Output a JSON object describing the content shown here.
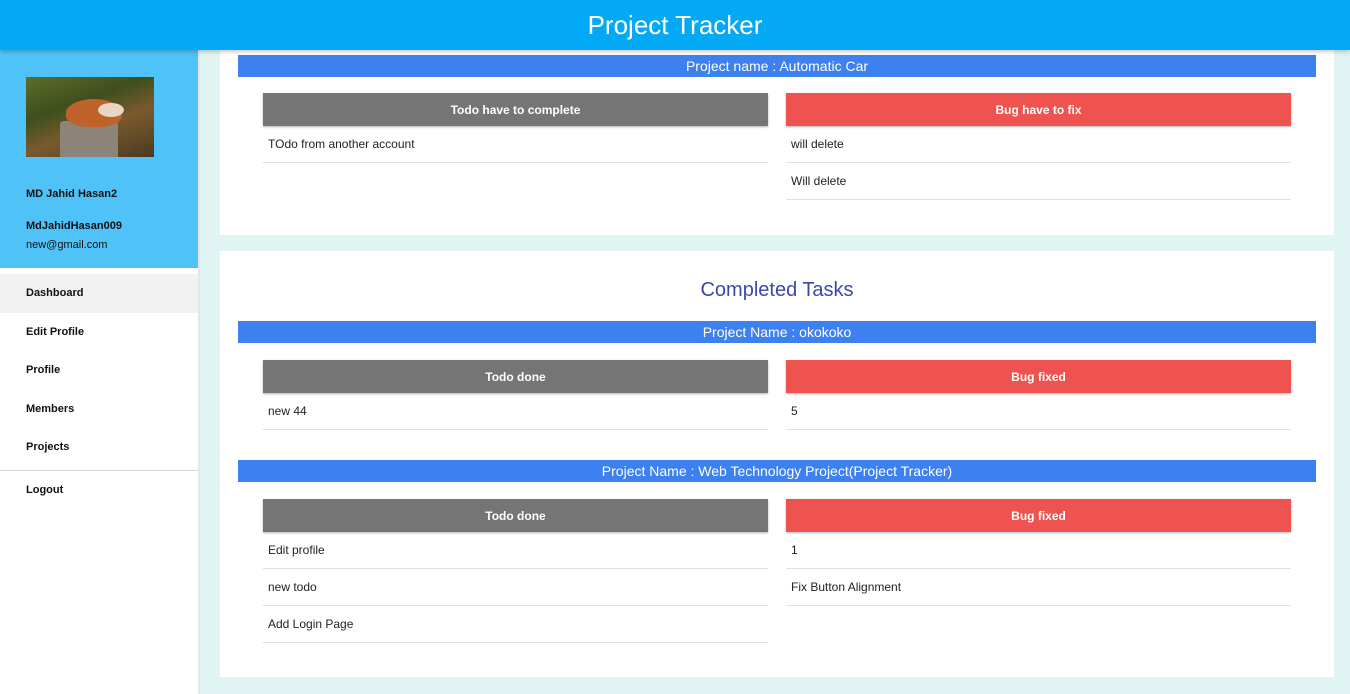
{
  "app": {
    "title": "Project Tracker"
  },
  "user": {
    "name": "MD Jahid Hasan2",
    "username": "MdJahidHasan009",
    "email": "new@gmail.com"
  },
  "nav": {
    "items": [
      {
        "label": "Dashboard"
      },
      {
        "label": "Edit Profile"
      },
      {
        "label": "Profile"
      },
      {
        "label": "Members"
      },
      {
        "label": "Projects"
      }
    ],
    "logout": "Logout"
  },
  "pending": {
    "project": "Project name : Automatic Car",
    "todo_header": "Todo have to complete",
    "bug_header": "Bug have to fix",
    "todos": [
      "TOdo from another account"
    ],
    "bugs": [
      "will delete",
      "Will delete"
    ]
  },
  "completed": {
    "title": "Completed Tasks",
    "projects": [
      {
        "name": "Project Name : okokoko",
        "todo_header": "Todo done",
        "bug_header": "Bug fixed",
        "todos": [
          "new 44"
        ],
        "bugs": [
          "5"
        ]
      },
      {
        "name": "Project Name : Web Technology Project(Project Tracker)",
        "todo_header": "Todo done",
        "bug_header": "Bug fixed",
        "todos": [
          "Edit profile",
          "new todo",
          "Add Login Page"
        ],
        "bugs": [
          "1",
          "Fix Button Alignment"
        ]
      }
    ]
  },
  "colors": {
    "header": "#03a9f4",
    "sidebar_profile": "#4fc3f7",
    "project_bar": "#3d80ef",
    "todo_header": "#757575",
    "bug_header": "#ef5350",
    "section_title": "#3949ab"
  },
  "icons": {
    "avatar": "fox-on-stump-photo"
  }
}
